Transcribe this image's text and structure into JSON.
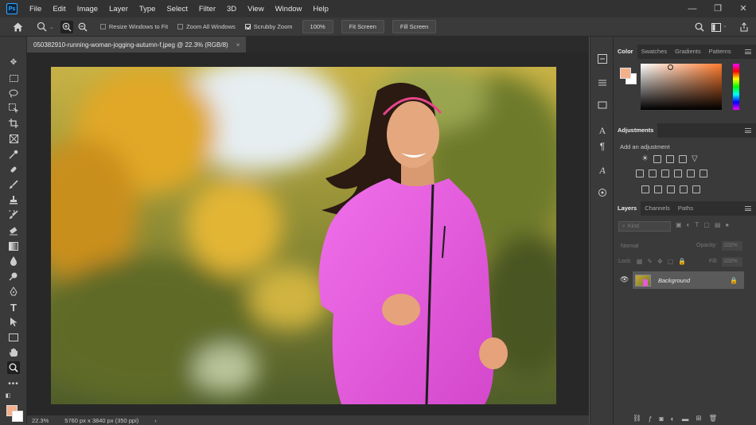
{
  "app": {
    "logo": "Ps"
  },
  "menu": [
    "File",
    "Edit",
    "Image",
    "Layer",
    "Type",
    "Select",
    "Filter",
    "3D",
    "View",
    "Window",
    "Help"
  ],
  "window_controls": {
    "minimize": "—",
    "maximize": "❐",
    "close": "✕"
  },
  "options_bar": {
    "resize_windows_label": "Resize Windows to Fit",
    "zoom_all_label": "Zoom All Windows",
    "scrubby_zoom_label": "Scrubby Zoom",
    "zoom_100": "100%",
    "fit_screen": "Fit Screen",
    "fill_screen": "Fill Screen"
  },
  "document": {
    "tab_title": "050382910-running-woman-jogging-autumn-f.jpeg @ 22.3% (RGB/8)",
    "close": "×"
  },
  "status": {
    "zoom": "22.3%",
    "doc_info": "5760 px x 3840 px (350 ppi)",
    "arrow": "›"
  },
  "color_panel": {
    "tabs": [
      "Color",
      "Swatches",
      "Gradients",
      "Patterns"
    ],
    "fg": "#f4b08a",
    "bg": "#ffffff"
  },
  "adjustments_panel": {
    "title": "Adjustments",
    "hint": "Add an adjustment"
  },
  "layers_panel": {
    "tabs": [
      "Layers",
      "Channels",
      "Paths"
    ],
    "kind_placeholder": "Kind",
    "blend_mode": "Normal",
    "opacity_label": "Opacity:",
    "opacity_value": "100%",
    "lock_label": "Lock:",
    "fill_label": "Fill:",
    "fill_value": "100%",
    "layers": [
      {
        "name": "Background"
      }
    ]
  }
}
